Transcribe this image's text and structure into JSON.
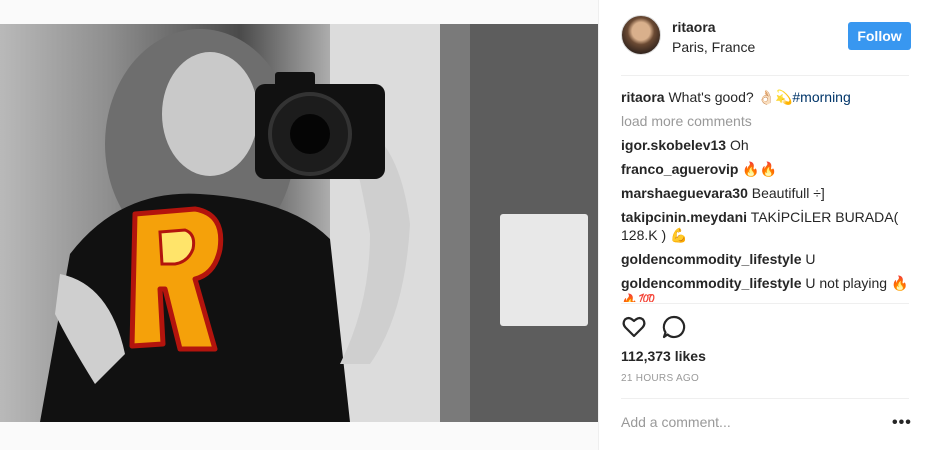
{
  "post": {
    "username": "ritaora",
    "location": "Paris, France",
    "follow_label": "Follow",
    "caption": {
      "user": "ritaora",
      "text": "What's good? 👌🏻💫",
      "hashtag": "#morning"
    },
    "load_more_label": "load more comments",
    "comments": [
      {
        "user": "igor.skobelev13",
        "text": "Oh"
      },
      {
        "user": "franco_aguerovip",
        "text": "🔥🔥"
      },
      {
        "user": "marshaeguevara30",
        "text": "Beautifull ÷]"
      },
      {
        "user": "takipcinin.meydani",
        "text": "TAKİPCİLER BURADA( 128.K ) 💪"
      },
      {
        "user": "goldencommodity_lifestyle",
        "text": "U"
      },
      {
        "user": "goldencommodity_lifestyle",
        "text": "U not playing 🔥🔥💯"
      }
    ],
    "likes": "112,373 likes",
    "time_ago": "21 HOURS AGO",
    "comment_placeholder": "Add a comment...",
    "more_label": "•••",
    "accent": "#3897f0"
  }
}
